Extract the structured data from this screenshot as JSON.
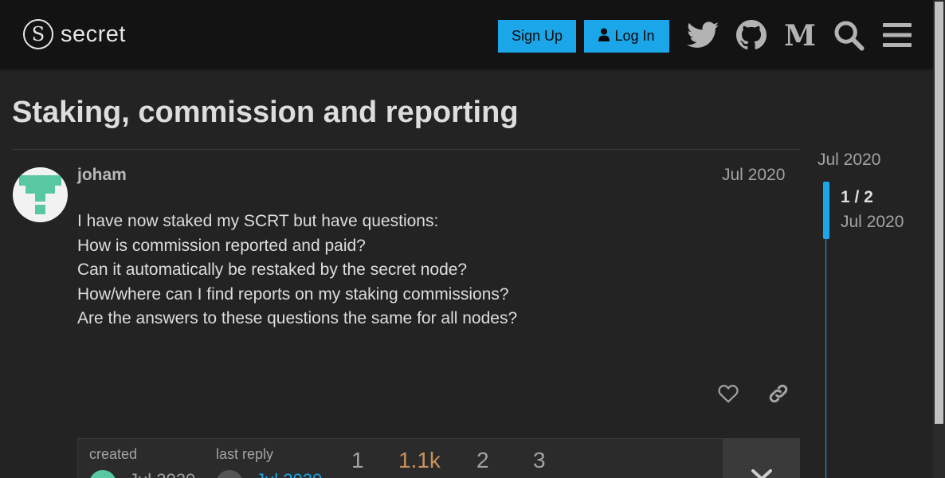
{
  "header": {
    "logo_text": "secret",
    "signup_label": "Sign Up",
    "login_label": "Log In"
  },
  "topic": {
    "title": "Staking, commission and reporting"
  },
  "post": {
    "username": "joham",
    "date": "Jul 2020",
    "lines": [
      "I have now staked my SCRT but have questions:",
      "How is commission reported and paid?",
      "Can it automatically be restaked by the secret node?",
      "How/where can I find reports on my staking commissions?",
      "Are the answers to these questions the same for all nodes?"
    ]
  },
  "topic_map": {
    "created_label": "created",
    "created_date": "Jul 2020",
    "last_reply_label": "last reply",
    "last_reply_date": "Jul 2020",
    "replies": "1",
    "views": "1.1k",
    "users": "2",
    "links": "3"
  },
  "timeline": {
    "top_date": "Jul 2020",
    "count": "1 / 2",
    "current_date": "Jul 2020"
  },
  "colors": {
    "accent": "#1ba6e9",
    "header_bg": "#131313",
    "page_bg": "#232323",
    "views_highlight": "#c9915d"
  },
  "icons": [
    "twitter-icon",
    "github-icon",
    "medium-icon",
    "search-icon",
    "hamburger-menu-icon",
    "heart-icon",
    "link-icon",
    "chevron-down-icon",
    "user-icon"
  ]
}
